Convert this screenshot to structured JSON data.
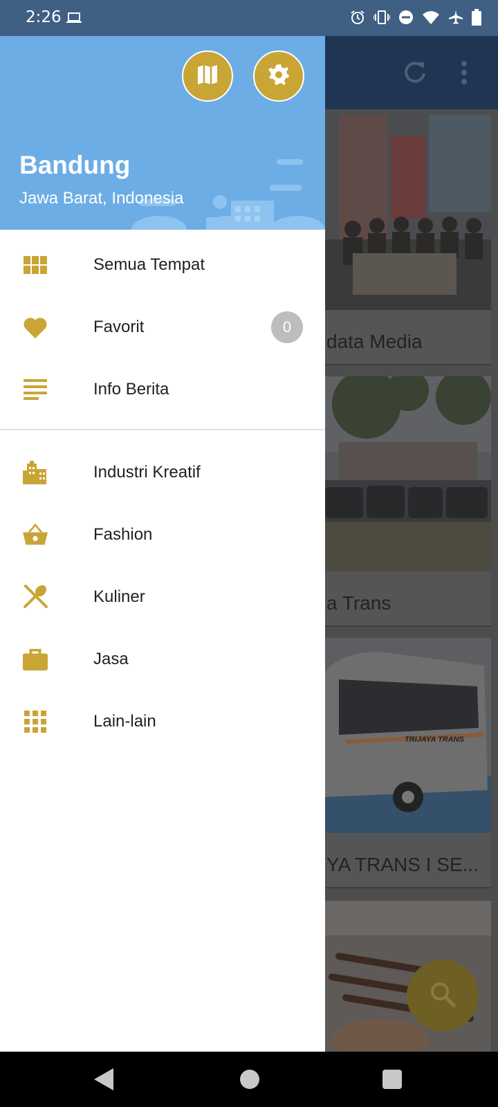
{
  "status_bar": {
    "time": "2:26",
    "icons": [
      "laptop-icon",
      "alarm-icon",
      "vibrate-icon",
      "do-not-disturb-icon",
      "wifi-icon",
      "airplane-icon",
      "battery-icon"
    ]
  },
  "background_app": {
    "toolbar_icons": [
      "refresh-icon",
      "more-vert-icon"
    ],
    "cards": [
      {
        "title": "data Media"
      },
      {
        "title": "a Trans"
      },
      {
        "title": "YA TRANS I SE..."
      },
      {
        "title": ""
      }
    ],
    "bus_livery_text": "TRIJAYA TRANS",
    "fab_icon": "search-icon"
  },
  "drawer": {
    "header": {
      "city": "Bandung",
      "region": "Jawa Barat, Indonesia",
      "buttons": [
        "map-icon",
        "settings-icon"
      ]
    },
    "main_items": [
      {
        "label": "Semua Tempat",
        "icon": "grid-icon"
      },
      {
        "label": "Favorit",
        "icon": "heart-icon",
        "badge": "0"
      },
      {
        "label": "Info Berita",
        "icon": "list-icon"
      }
    ],
    "category_items": [
      {
        "label": "Industri Kreatif",
        "icon": "building-icon"
      },
      {
        "label": "Fashion",
        "icon": "basket-icon"
      },
      {
        "label": "Kuliner",
        "icon": "utensils-icon"
      },
      {
        "label": "Jasa",
        "icon": "briefcase-icon"
      },
      {
        "label": "Lain-lain",
        "icon": "apps-icon"
      }
    ]
  },
  "colors": {
    "accent": "#c9a536",
    "header_bg": "#6cade6",
    "status_bar": "#3f5f83"
  }
}
